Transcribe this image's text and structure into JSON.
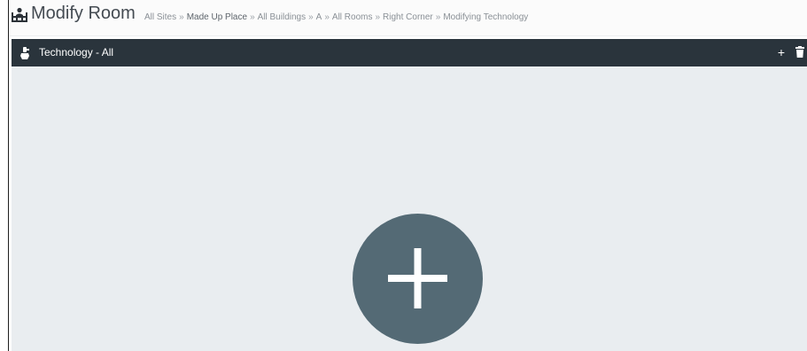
{
  "header": {
    "icon": "meeting-room-icon",
    "title": "Modify Room",
    "breadcrumb": [
      {
        "label": "All Sites"
      },
      {
        "label": "Made Up Place"
      },
      {
        "label": "All Buildings"
      },
      {
        "label": "A"
      },
      {
        "label": "All Rooms"
      },
      {
        "label": "Right Corner"
      },
      {
        "label": "Modifying Technology"
      }
    ],
    "separator": "»"
  },
  "toolbar": {
    "icon": "technology-icon",
    "title": "Technology - All",
    "add_label": "+",
    "delete_icon": "trash-icon"
  },
  "content": {
    "fab_icon": "plus-icon"
  },
  "colors": {
    "toolbar_bg": "#2a343c",
    "content_bg": "#e9edf0",
    "fab_bg": "#546a75"
  }
}
